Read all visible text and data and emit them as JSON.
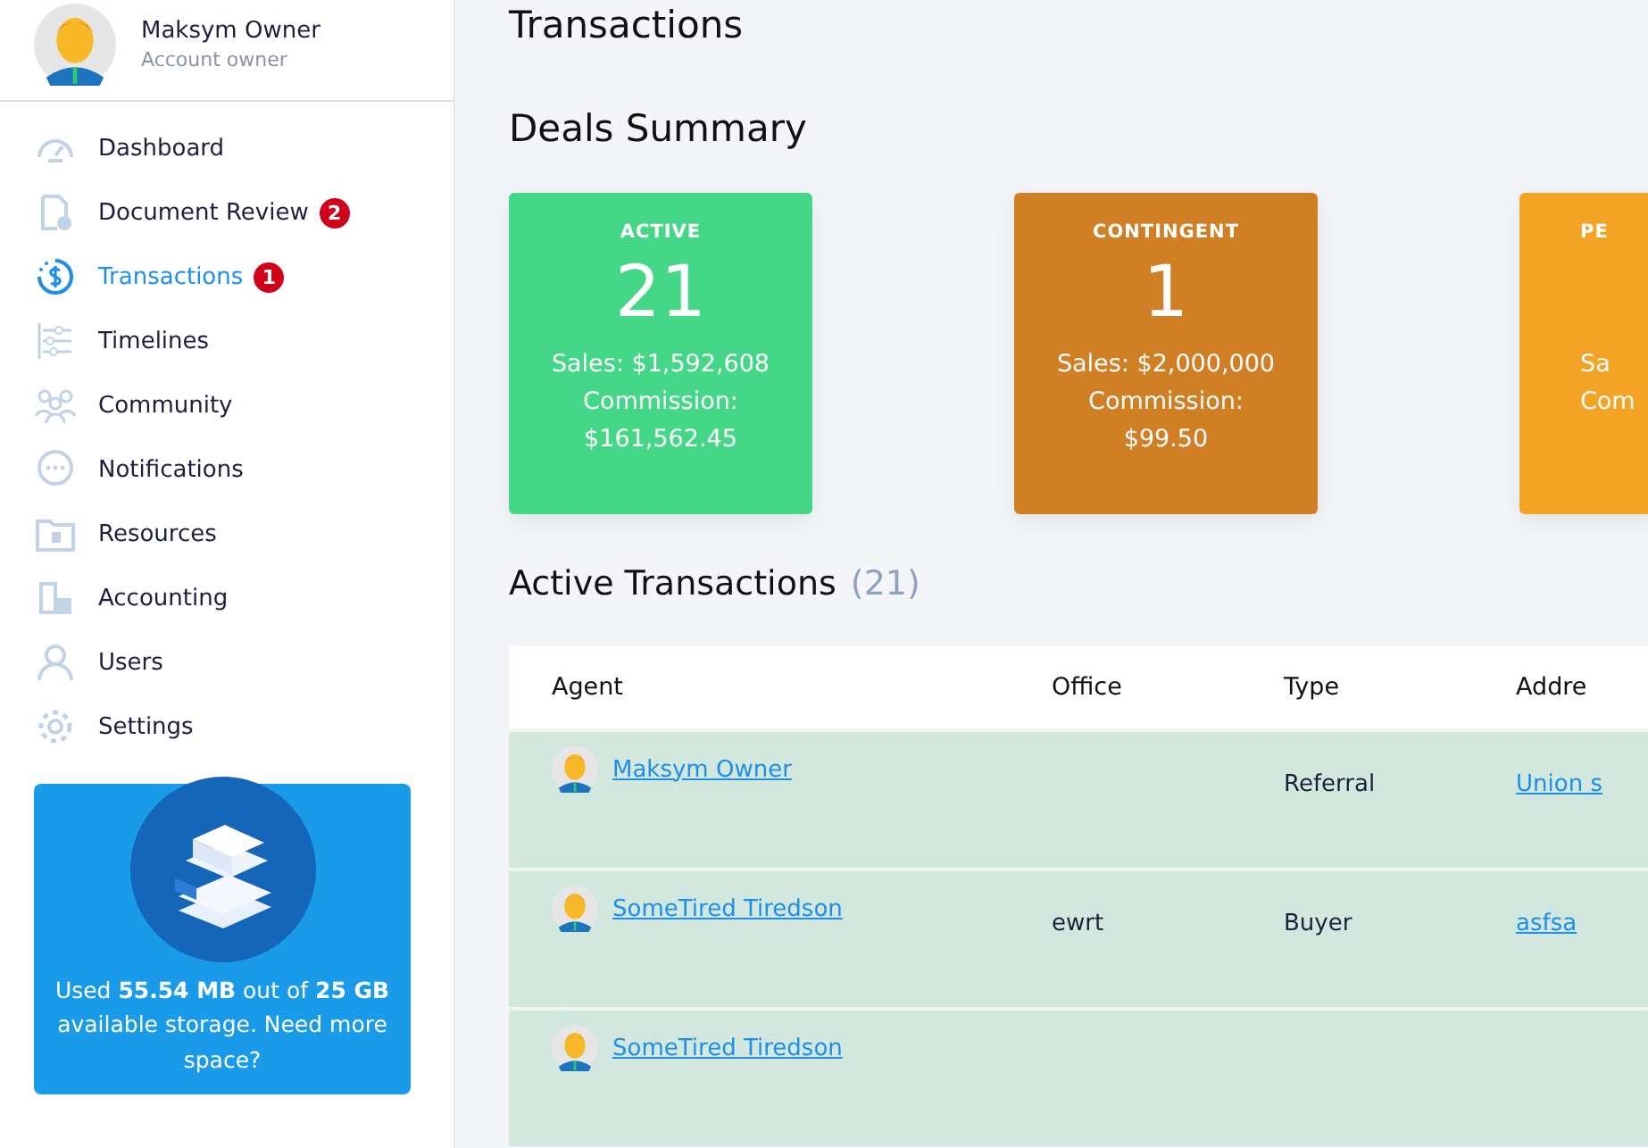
{
  "profile": {
    "name": "Maksym Owner",
    "role": "Account owner"
  },
  "nav": [
    {
      "label": "Dashboard",
      "selected": false
    },
    {
      "label": "Document Review",
      "selected": false,
      "badge": "2"
    },
    {
      "label": "Transactions",
      "selected": true,
      "badge": "1"
    },
    {
      "label": "Timelines",
      "selected": false
    },
    {
      "label": "Community",
      "selected": false
    },
    {
      "label": "Notifications",
      "selected": false
    },
    {
      "label": "Resources",
      "selected": false
    },
    {
      "label": "Accounting",
      "selected": false
    },
    {
      "label": "Users",
      "selected": false
    },
    {
      "label": "Settings",
      "selected": false
    }
  ],
  "storage": {
    "text": "Used **55.54 MB** out of **25 GB** available storage. Need more space?"
  },
  "page_title": "Transactions",
  "summary": {
    "title": "Deals Summary",
    "cards": [
      {
        "label": "ACTIVE",
        "count": "21",
        "sales": "Sales: $1,592,608",
        "commission": "Commission: $161,562.45",
        "color": "#43d787"
      },
      {
        "label": "CONTINGENT",
        "count": "1",
        "sales": "Sales: $2,000,000",
        "commission": "Commission: $99.50",
        "color": "#d17f25"
      },
      {
        "label": "PE",
        "sales": "Sa",
        "commission": "Com",
        "color": "#f4a425"
      }
    ]
  },
  "active": {
    "title": "Active Transactions",
    "count": "(21)",
    "columns": [
      "Agent",
      "Office",
      "Type",
      "Addre"
    ],
    "rows": [
      {
        "agent": "Maksym Owner",
        "type": "Referral",
        "address": "Union s"
      },
      {
        "agent": "SomeTired Tiredson",
        "office": "ewrt",
        "type": "Buyer",
        "address": "asfsa"
      },
      {
        "agent": "SomeTired Tiredson"
      }
    ]
  }
}
